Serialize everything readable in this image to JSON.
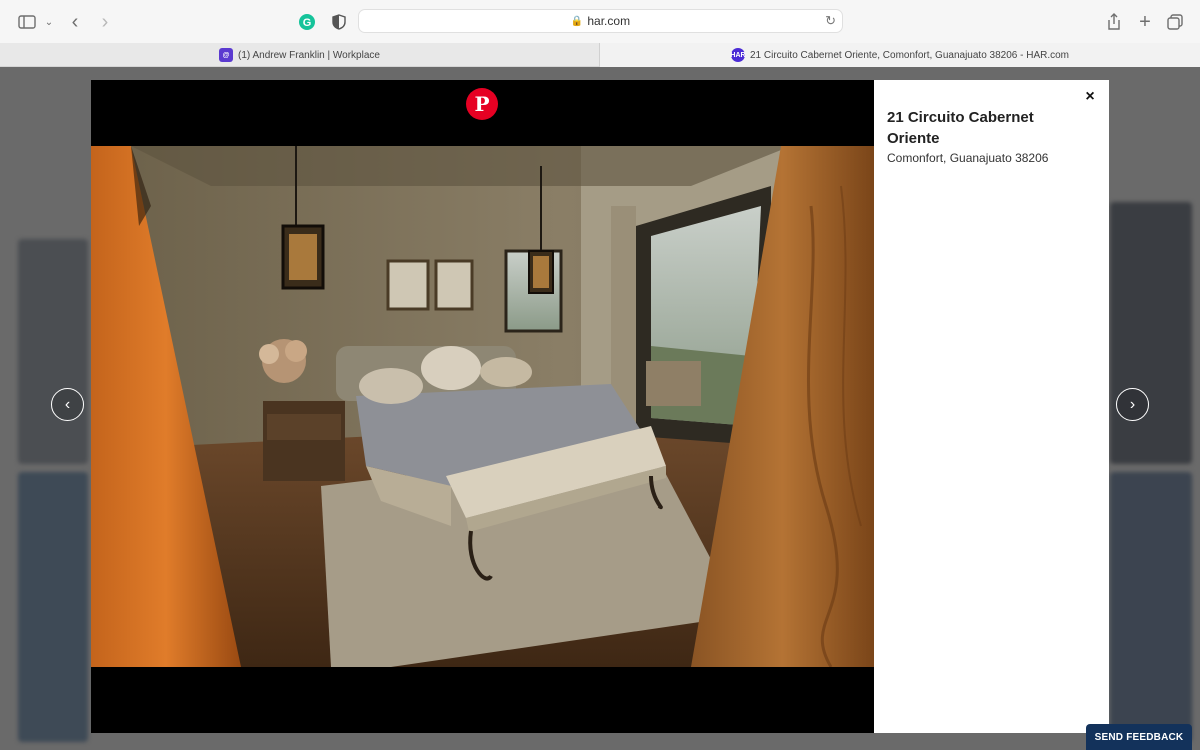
{
  "browser": {
    "url": "har.com",
    "tabs": [
      {
        "label": "(1) Andrew Franklin | Workplace",
        "favicon": "workplace-icon"
      },
      {
        "label": "21 Circuito Cabernet Oriente, Comonfort, Guanajuato 38206 - HAR.com",
        "favicon": "har-icon"
      }
    ],
    "icons": [
      "sidebar-icon",
      "chevron-down-icon",
      "back-icon",
      "forward-icon",
      "grammarly-icon",
      "shield-icon",
      "lock-icon",
      "reload-icon",
      "share-icon",
      "new-tab-icon",
      "tabs-overview-icon"
    ]
  },
  "modal": {
    "title": "21 Circuito Cabernet Oriente",
    "subtitle": "Comonfort, Guanajuato 38206",
    "close_symbol": "×",
    "pinterest_symbol": "P",
    "prev_symbol": "‹",
    "next_symbol": "›",
    "photo_alt": "Bedroom with lantern pendants, bed, bench and sliding doors to a patio"
  },
  "feedback_label": "SEND FEEDBACK",
  "colors": {
    "pinterest": "#e60023",
    "feedback_bg": "#13325b",
    "har_favicon": "#4b2bd6",
    "workplace_favicon": "#5b3ad0"
  }
}
